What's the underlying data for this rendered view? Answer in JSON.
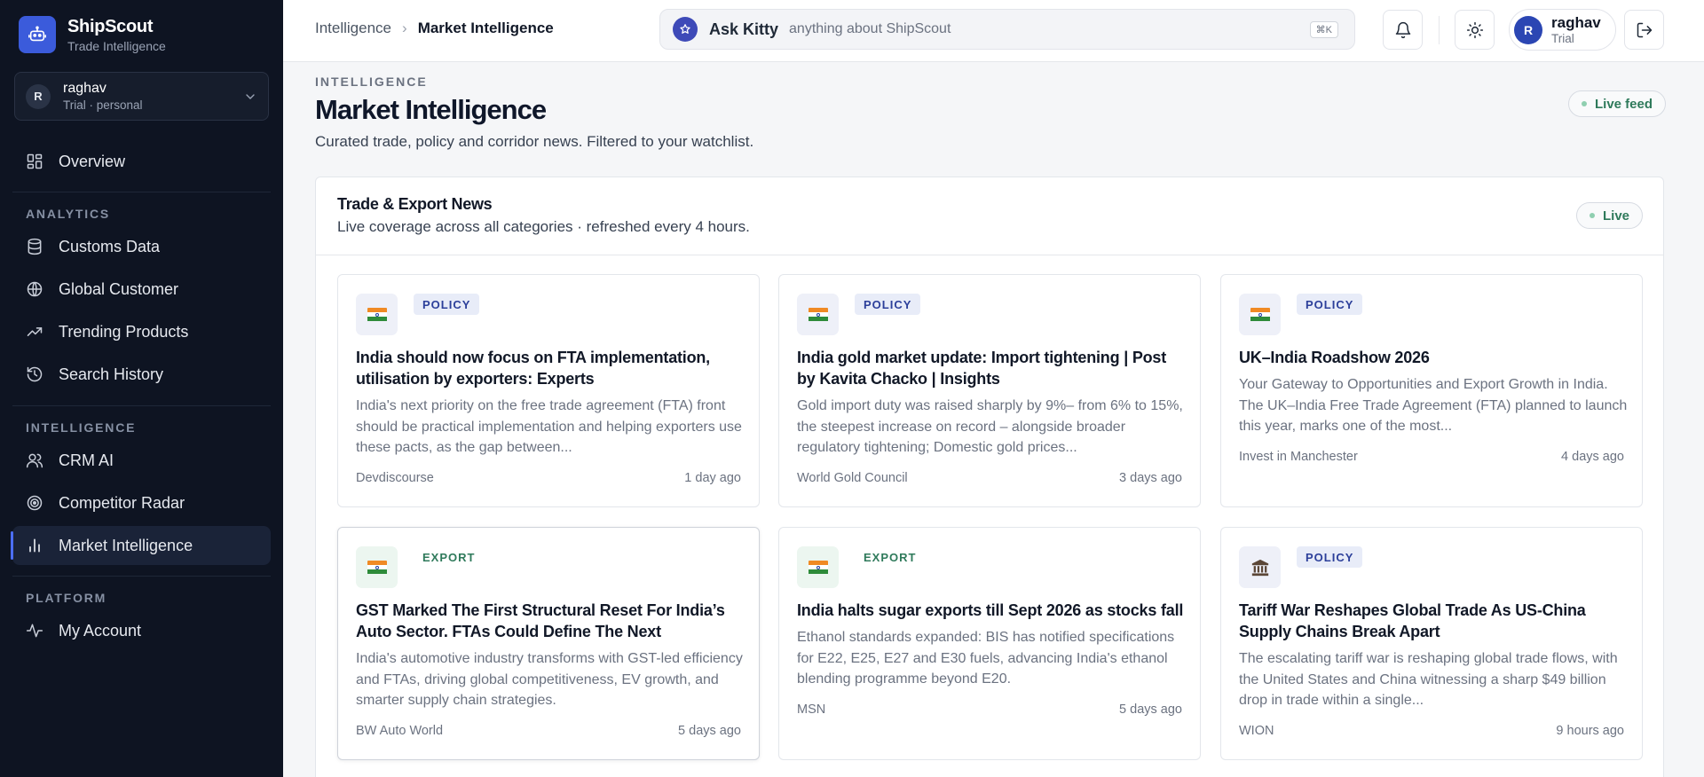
{
  "brand": {
    "name": "ShipScout",
    "subtitle": "Trade Intelligence"
  },
  "account_switcher": {
    "initial": "R",
    "name": "raghav",
    "plan": "Trial · personal"
  },
  "sidebar": {
    "overview": "Overview",
    "section_analytics": "ANALYTICS",
    "customs": "Customs Data",
    "global_customer": "Global Customer",
    "trending": "Trending Products",
    "history": "Search History",
    "section_intelligence": "INTELLIGENCE",
    "crm": "CRM AI",
    "competitor": "Competitor Radar",
    "market": "Market Intelligence",
    "section_platform": "PLATFORM",
    "account": "My Account",
    "active_item": "Market Intelligence"
  },
  "header": {
    "breadcrumb_root": "Intelligence",
    "breadcrumb_current": "Market Intelligence",
    "ask_title": "Ask Kitty",
    "ask_placeholder": "anything about ShipScout",
    "shortcut": "⌘K",
    "user_initial": "R",
    "user_name": "raghav",
    "user_plan": "Trial"
  },
  "page": {
    "eyebrow": "INTELLIGENCE",
    "title": "Market Intelligence",
    "subtitle": "Curated trade, policy and corridor news. Filtered to your watchlist.",
    "badge": "Live feed"
  },
  "news": {
    "title": "Trade & Export News",
    "subtitle": "Live coverage across all categories · refreshed every 4 hours.",
    "badge": "Live",
    "cards": [
      {
        "tag": "POLICY",
        "icon": "india-flag",
        "title": "India should now focus on FTA implementation, utilisation by exporters: Experts",
        "desc": "India's next priority on the free trade agreement (FTA) front should be practical implementation and helping exporters use these pacts, as the gap between...",
        "source": "Devdiscourse",
        "time": "1 day ago"
      },
      {
        "tag": "POLICY",
        "icon": "india-flag",
        "title": "India gold market update: Import tightening | Post by Kavita Chacko | Insights",
        "desc": "Gold import duty was raised sharply by 9%– from 6% to 15%, the steepest increase on record – alongside broader regulatory tightening; Domestic gold prices...",
        "source": "World Gold Council",
        "time": "3 days ago"
      },
      {
        "tag": "POLICY",
        "icon": "india-flag",
        "title": "UK–India Roadshow 2026",
        "desc": "Your Gateway to Opportunities and Export Growth in India. The UK–India Free Trade Agreement (FTA) planned to launch this year, marks one of the most...",
        "source": "Invest in Manchester",
        "time": "4 days ago"
      },
      {
        "tag": "EXPORT",
        "icon": "india-flag",
        "title": "GST Marked The First Structural Reset For India’s Auto Sector. FTAs Could Define The Next",
        "desc": "India's automotive industry transforms with GST-led efficiency and FTAs, driving global competitiveness, EV growth, and smarter supply chain strategies.",
        "source": "BW Auto World",
        "time": "5 days ago"
      },
      {
        "tag": "EXPORT",
        "icon": "india-flag",
        "title": "India halts sugar exports till Sept 2026 as stocks fall",
        "desc": "Ethanol standards expanded: BIS has notified specifications for E22, E25, E27 and E30 fuels, advancing India's ethanol blending programme beyond E20.",
        "source": "MSN",
        "time": "5 days ago"
      },
      {
        "tag": "POLICY",
        "icon": "bank-icon",
        "title": "Tariff War Reshapes Global Trade As US-China Supply Chains Break Apart",
        "desc": "The escalating tariff war is reshaping global trade flows, with the United States and China witnessing a sharp $49 billion drop in trade within a single...",
        "source": "WION",
        "time": "9 hours ago"
      }
    ]
  },
  "colors": {
    "sidebar_bg": "#0e1422",
    "accent": "#3b5bdb",
    "live_green": "#2f7a5b"
  }
}
